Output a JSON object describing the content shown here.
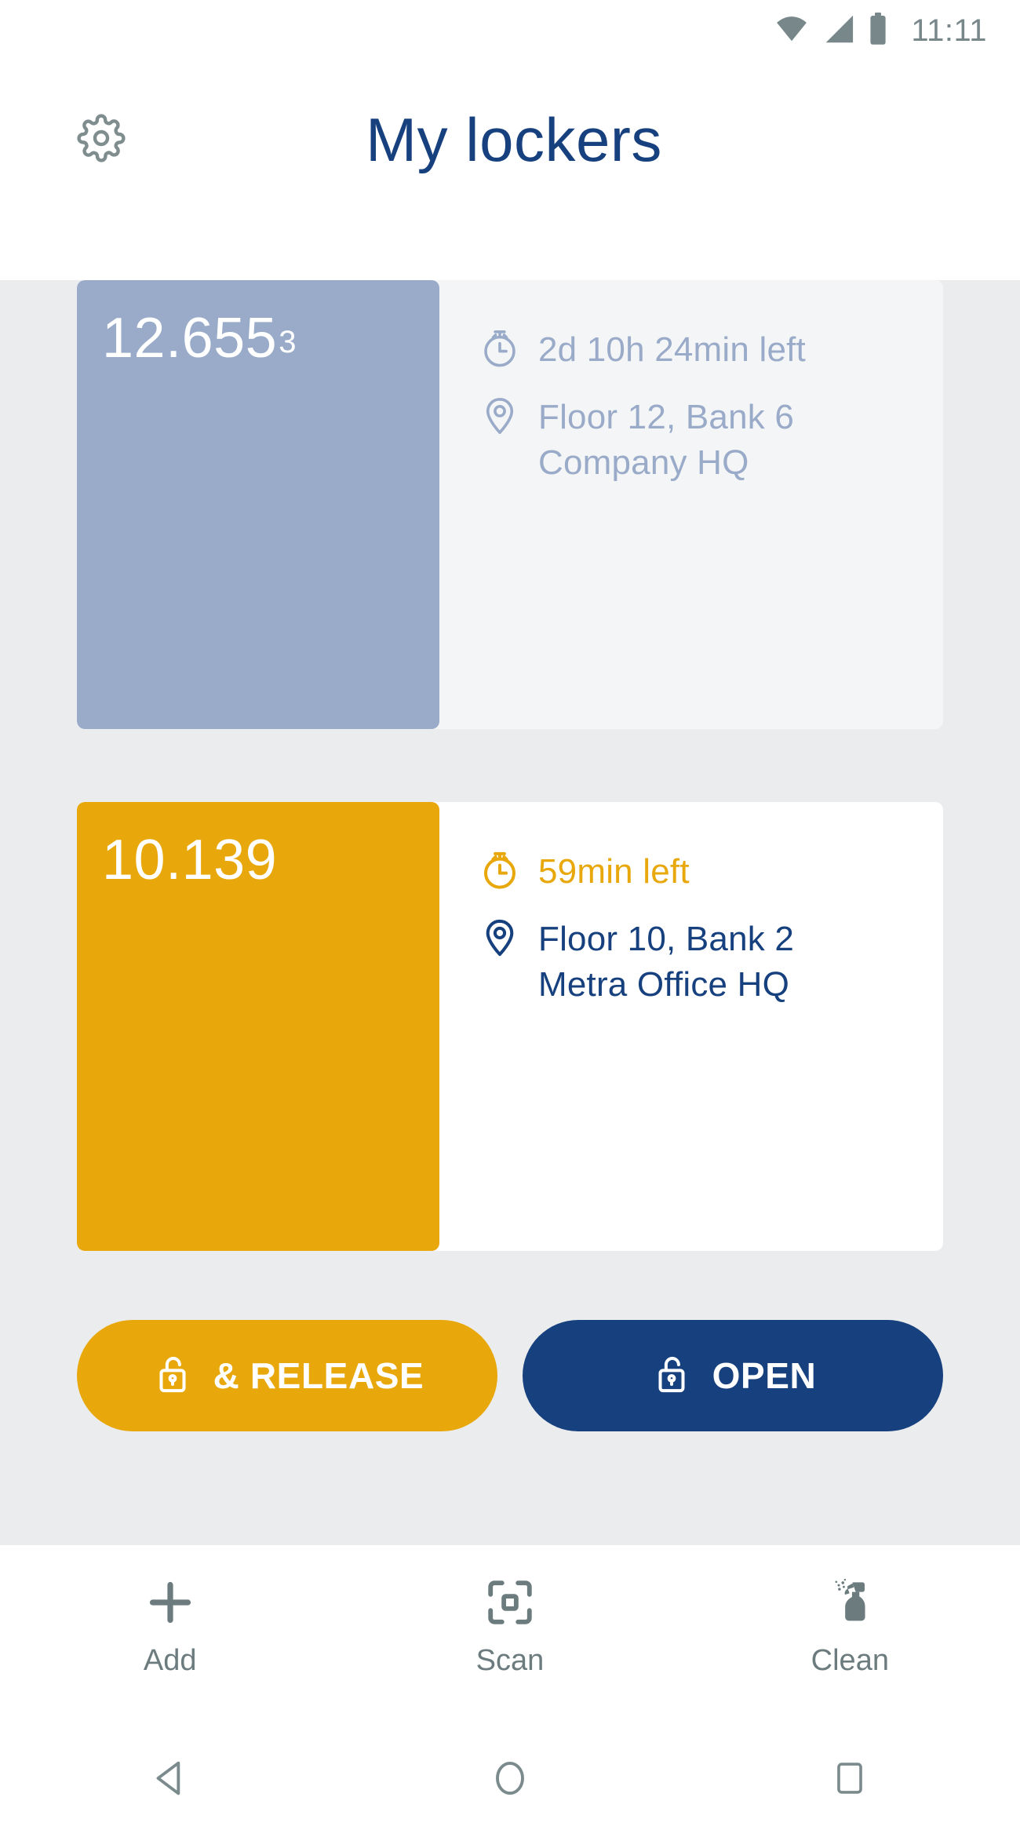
{
  "status_bar": {
    "time": "11:11",
    "icons": [
      "wifi-icon",
      "cellular-signal-icon",
      "battery-icon"
    ]
  },
  "header": {
    "title": "My lockers",
    "settings_icon": "gear-icon",
    "title_color": "#17417e"
  },
  "colors": {
    "page_background": "#ebecee",
    "inactive_tile": "#9aabc9",
    "inactive_panel": "#f4f5f6",
    "active_tile": "#e8a80c",
    "active_panel": "#ffffff",
    "navy": "#17417e",
    "amber": "#e8a80c",
    "muted_blue": "#9aabc9",
    "icon_gray": "#6c7c7e"
  },
  "lockers": [
    {
      "number": "12.655",
      "superscript": "3",
      "state": "inactive",
      "time_icon": "stopwatch-icon",
      "time_left": "2d 10h 24min left",
      "location_icon": "map-pin-icon",
      "location_line1": "Floor 12, Bank 6",
      "location_line2": "Company HQ"
    },
    {
      "number": "10.139",
      "superscript": "",
      "state": "active",
      "time_icon": "stopwatch-icon",
      "time_left": "59min left",
      "location_icon": "map-pin-icon",
      "location_line1": "Floor 10, Bank 2",
      "location_line2": "Metra Office HQ"
    }
  ],
  "actions": {
    "release_label": "& RELEASE",
    "release_icon": "unlocked-padlock-icon",
    "open_label": "OPEN",
    "open_icon": "unlocked-padlock-icon"
  },
  "tabs": [
    {
      "label": "Add",
      "icon": "plus-icon"
    },
    {
      "label": "Scan",
      "icon": "scan-frame-icon"
    },
    {
      "label": "Clean",
      "icon": "spray-bottle-icon"
    }
  ],
  "nav_bar": {
    "back": "back-triangle-icon",
    "home": "home-circle-icon",
    "recents": "recents-square-icon"
  }
}
